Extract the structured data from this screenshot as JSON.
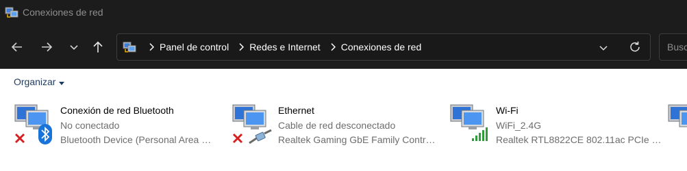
{
  "window": {
    "title": "Conexiones de red"
  },
  "address_bar": {
    "crumbs": [
      "Panel de control",
      "Redes e Internet",
      "Conexiones de red"
    ]
  },
  "search": {
    "placeholder": "Busca"
  },
  "command_bar": {
    "organize_label": "Organizar"
  },
  "connections": [
    {
      "name": "Conexión de red Bluetooth",
      "status": "No conectado",
      "device": "Bluetooth Device (Personal Area …",
      "badge_icon": "bluetooth-icon",
      "state_icon": "red-x-icon"
    },
    {
      "name": "Ethernet",
      "status": "Cable de red desconectado",
      "device": "Realtek Gaming GbE Family Contr…",
      "badge_icon": "network-cable-icon",
      "state_icon": "red-x-icon"
    },
    {
      "name": "Wi-Fi",
      "status": "WiFi_2.4G",
      "device": "Realtek RTL8822CE 802.11ac PCIe …",
      "badge_icon": "wifi-signal-bars-icon",
      "state_icon": "none"
    }
  ],
  "colors": {
    "titlebar_bg": "#1c1c1c",
    "text_secondary": "#6d6d6d",
    "organize_text": "#1e3a5f",
    "error_red": "#d42020",
    "signal_green": "#2e9e3a",
    "bluetooth_blue": "#1a73d9"
  }
}
